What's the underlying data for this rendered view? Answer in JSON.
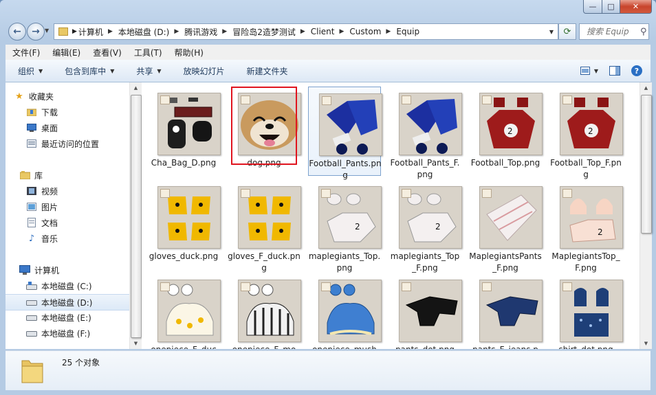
{
  "window": {
    "caption_minimize": "—",
    "caption_maximize": "□",
    "caption_close": "✕"
  },
  "nav": {
    "back_glyph": "←",
    "forward_glyph": "→"
  },
  "address": {
    "crumbs": [
      "计算机",
      "本地磁盘 (D:)",
      "腾讯游戏",
      "冒险岛2造梦测试",
      "Client",
      "Custom",
      "Equip"
    ]
  },
  "search": {
    "placeholder": "搜索 Equip"
  },
  "menu": {
    "items": [
      "文件(F)",
      "编辑(E)",
      "查看(V)",
      "工具(T)",
      "帮助(H)"
    ]
  },
  "toolbar": {
    "organize": "组织",
    "include_library": "包含到库中",
    "share": "共享",
    "slideshow": "放映幻灯片",
    "new_folder": "新建文件夹"
  },
  "sidebar": {
    "favorites": "收藏夹",
    "downloads": "下载",
    "desktop": "桌面",
    "recent": "最近访问的位置",
    "libraries": "库",
    "videos": "视频",
    "pictures": "图片",
    "documents": "文档",
    "music": "音乐",
    "computer": "计算机",
    "drive_c": "本地磁盘 (C:)",
    "drive_d": "本地磁盘 (D:)",
    "drive_e": "本地磁盘 (E:)",
    "drive_f": "本地磁盘 (F:)"
  },
  "files": [
    {
      "name": "Cha_Bag_D.png",
      "art": "bag"
    },
    {
      "name": "dog.png",
      "art": "dog"
    },
    {
      "name": "Football_Pants.png",
      "art": "pants_blue"
    },
    {
      "name": "Football_Pants_F.png",
      "art": "pants_blue"
    },
    {
      "name": "Football_Top.png",
      "art": "top_red"
    },
    {
      "name": "Football_Top_F.png",
      "art": "top_red"
    },
    {
      "name": "gloves_duck.png",
      "art": "gloves"
    },
    {
      "name": "gloves_F_duck.png",
      "art": "gloves"
    },
    {
      "name": "maplegiants_Top.png",
      "art": "white_top"
    },
    {
      "name": "maplegiants_Top_F.png",
      "art": "white_top"
    },
    {
      "name": "MaplegiantsPants_F.png",
      "art": "white_pants"
    },
    {
      "name": "MaplegiantsTop_F.png",
      "art": "peach_top"
    },
    {
      "name": "onepiece_F_duc",
      "art": "dress_duck"
    },
    {
      "name": "onepiece_F_mo",
      "art": "dress_stripe"
    },
    {
      "name": "onepiece_mush",
      "art": "dress_blue"
    },
    {
      "name": "pants_dot.png",
      "art": "pants_black"
    },
    {
      "name": "pants_F_jeans.p",
      "art": "pants_jeans"
    },
    {
      "name": "shirt_dot.png",
      "art": "shirt_dot"
    }
  ],
  "status": {
    "count": "25 个对象"
  },
  "colors": {
    "selection_highlight": "#e0141e",
    "accent": "#1e395b"
  }
}
